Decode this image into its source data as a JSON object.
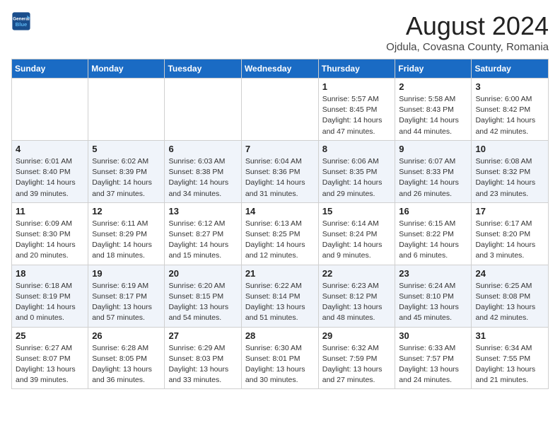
{
  "header": {
    "logo_general": "General",
    "logo_blue": "Blue",
    "month_year": "August 2024",
    "location": "Ojdula, Covasna County, Romania"
  },
  "days_of_week": [
    "Sunday",
    "Monday",
    "Tuesday",
    "Wednesday",
    "Thursday",
    "Friday",
    "Saturday"
  ],
  "weeks": [
    [
      {
        "day": "",
        "info": ""
      },
      {
        "day": "",
        "info": ""
      },
      {
        "day": "",
        "info": ""
      },
      {
        "day": "",
        "info": ""
      },
      {
        "day": "1",
        "info": "Sunrise: 5:57 AM\nSunset: 8:45 PM\nDaylight: 14 hours\nand 47 minutes."
      },
      {
        "day": "2",
        "info": "Sunrise: 5:58 AM\nSunset: 8:43 PM\nDaylight: 14 hours\nand 44 minutes."
      },
      {
        "day": "3",
        "info": "Sunrise: 6:00 AM\nSunset: 8:42 PM\nDaylight: 14 hours\nand 42 minutes."
      }
    ],
    [
      {
        "day": "4",
        "info": "Sunrise: 6:01 AM\nSunset: 8:40 PM\nDaylight: 14 hours\nand 39 minutes."
      },
      {
        "day": "5",
        "info": "Sunrise: 6:02 AM\nSunset: 8:39 PM\nDaylight: 14 hours\nand 37 minutes."
      },
      {
        "day": "6",
        "info": "Sunrise: 6:03 AM\nSunset: 8:38 PM\nDaylight: 14 hours\nand 34 minutes."
      },
      {
        "day": "7",
        "info": "Sunrise: 6:04 AM\nSunset: 8:36 PM\nDaylight: 14 hours\nand 31 minutes."
      },
      {
        "day": "8",
        "info": "Sunrise: 6:06 AM\nSunset: 8:35 PM\nDaylight: 14 hours\nand 29 minutes."
      },
      {
        "day": "9",
        "info": "Sunrise: 6:07 AM\nSunset: 8:33 PM\nDaylight: 14 hours\nand 26 minutes."
      },
      {
        "day": "10",
        "info": "Sunrise: 6:08 AM\nSunset: 8:32 PM\nDaylight: 14 hours\nand 23 minutes."
      }
    ],
    [
      {
        "day": "11",
        "info": "Sunrise: 6:09 AM\nSunset: 8:30 PM\nDaylight: 14 hours\nand 20 minutes."
      },
      {
        "day": "12",
        "info": "Sunrise: 6:11 AM\nSunset: 8:29 PM\nDaylight: 14 hours\nand 18 minutes."
      },
      {
        "day": "13",
        "info": "Sunrise: 6:12 AM\nSunset: 8:27 PM\nDaylight: 14 hours\nand 15 minutes."
      },
      {
        "day": "14",
        "info": "Sunrise: 6:13 AM\nSunset: 8:25 PM\nDaylight: 14 hours\nand 12 minutes."
      },
      {
        "day": "15",
        "info": "Sunrise: 6:14 AM\nSunset: 8:24 PM\nDaylight: 14 hours\nand 9 minutes."
      },
      {
        "day": "16",
        "info": "Sunrise: 6:15 AM\nSunset: 8:22 PM\nDaylight: 14 hours\nand 6 minutes."
      },
      {
        "day": "17",
        "info": "Sunrise: 6:17 AM\nSunset: 8:20 PM\nDaylight: 14 hours\nand 3 minutes."
      }
    ],
    [
      {
        "day": "18",
        "info": "Sunrise: 6:18 AM\nSunset: 8:19 PM\nDaylight: 14 hours\nand 0 minutes."
      },
      {
        "day": "19",
        "info": "Sunrise: 6:19 AM\nSunset: 8:17 PM\nDaylight: 13 hours\nand 57 minutes."
      },
      {
        "day": "20",
        "info": "Sunrise: 6:20 AM\nSunset: 8:15 PM\nDaylight: 13 hours\nand 54 minutes."
      },
      {
        "day": "21",
        "info": "Sunrise: 6:22 AM\nSunset: 8:14 PM\nDaylight: 13 hours\nand 51 minutes."
      },
      {
        "day": "22",
        "info": "Sunrise: 6:23 AM\nSunset: 8:12 PM\nDaylight: 13 hours\nand 48 minutes."
      },
      {
        "day": "23",
        "info": "Sunrise: 6:24 AM\nSunset: 8:10 PM\nDaylight: 13 hours\nand 45 minutes."
      },
      {
        "day": "24",
        "info": "Sunrise: 6:25 AM\nSunset: 8:08 PM\nDaylight: 13 hours\nand 42 minutes."
      }
    ],
    [
      {
        "day": "25",
        "info": "Sunrise: 6:27 AM\nSunset: 8:07 PM\nDaylight: 13 hours\nand 39 minutes."
      },
      {
        "day": "26",
        "info": "Sunrise: 6:28 AM\nSunset: 8:05 PM\nDaylight: 13 hours\nand 36 minutes."
      },
      {
        "day": "27",
        "info": "Sunrise: 6:29 AM\nSunset: 8:03 PM\nDaylight: 13 hours\nand 33 minutes."
      },
      {
        "day": "28",
        "info": "Sunrise: 6:30 AM\nSunset: 8:01 PM\nDaylight: 13 hours\nand 30 minutes."
      },
      {
        "day": "29",
        "info": "Sunrise: 6:32 AM\nSunset: 7:59 PM\nDaylight: 13 hours\nand 27 minutes."
      },
      {
        "day": "30",
        "info": "Sunrise: 6:33 AM\nSunset: 7:57 PM\nDaylight: 13 hours\nand 24 minutes."
      },
      {
        "day": "31",
        "info": "Sunrise: 6:34 AM\nSunset: 7:55 PM\nDaylight: 13 hours\nand 21 minutes."
      }
    ]
  ]
}
